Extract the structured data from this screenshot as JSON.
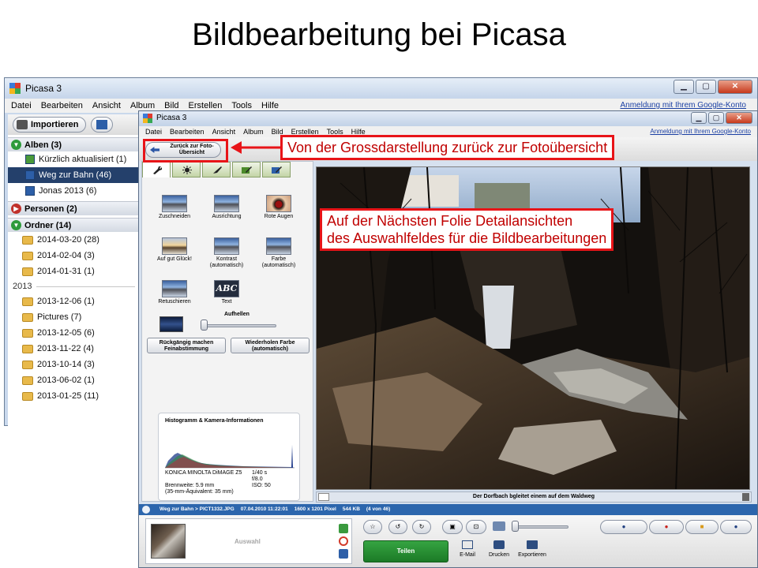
{
  "slide": {
    "title": "Bildbearbeitung bei Picasa"
  },
  "back_window": {
    "title": "Picasa 3",
    "menu": [
      "Datei",
      "Bearbeiten",
      "Ansicht",
      "Album",
      "Bild",
      "Erstellen",
      "Tools",
      "Hilfe"
    ],
    "login_link": "Anmeldung mit Ihrem Google-Konto",
    "import_label": "Importieren",
    "sections": {
      "albums": "Alben (3)",
      "people": "Personen (2)",
      "folders": "Ordner (14)"
    },
    "albums": [
      "Kürzlich aktualisiert (1)",
      "Weg zur Bahn (46)",
      "Jonas 2013 (6)"
    ],
    "folders_2014": [
      "2014-03-20 (28)",
      "2014-02-04 (3)",
      "2014-01-31 (1)"
    ],
    "year_divider": "2013",
    "folders_2013": [
      "2013-12-06 (1)",
      "Pictures (7)",
      "2013-12-05 (6)",
      "2013-11-22 (4)",
      "2013-10-14 (3)",
      "2013-06-02 (1)",
      "2013-01-25 (11)"
    ]
  },
  "front_window": {
    "title": "Picasa 3",
    "menu": [
      "Datei",
      "Bearbeiten",
      "Ansicht",
      "Album",
      "Bild",
      "Erstellen",
      "Tools",
      "Hilfe"
    ],
    "login_link": "Anmeldung mit Ihrem Google-Konto",
    "back_button": "Zurück zur Foto-Übersicht",
    "edit_tools": [
      "Zuschneiden",
      "Ausrichtung",
      "Rote Augen",
      "Auf gut Glück!",
      "Kontrast (automatisch)",
      "Farbe (automatisch)",
      "Retuschieren",
      "Text"
    ],
    "text_thumb": "ABC",
    "slider_label": "Aufhellen",
    "undo_button": "Rückgängig machen Feinabstimmung",
    "redo_button": "Wiederholen Farbe (automatisch)",
    "histogram": {
      "title": "Histogramm & Kamera-Informationen",
      "camera": "KONICA MINOLTA  DiMAGE Z5",
      "exposure": "1/40 s",
      "aperture": "f/8.0",
      "focal": "Brennweite: 5.9 mm",
      "iso": "ISO: 50",
      "equiv": "(35-mm-Äquivalent:  35 mm)"
    },
    "caption": "Der Dorfbach bgleitet einem auf dem Waldweg",
    "status": {
      "path": "Weg zur Bahn > PICT1332.JPG",
      "date": "07.04.2010 11:22:01",
      "dims": "1600 x 1201 Pixel",
      "size": "544 KB",
      "pos": "(4 von 46)"
    },
    "tray_label": "Auswahl",
    "share_button": "Teilen",
    "actions": [
      "E-Mail",
      "Drucken",
      "Exportieren"
    ]
  },
  "callouts": {
    "back_hint": "Von der Grossdarstellung zurück zur Fotoübersicht",
    "detail_hint_line1": "Auf der Nächsten Folie Detailansichten",
    "detail_hint_line2": "des Auswahlfeldes für die Bildbearbeitungen"
  },
  "colors": {
    "callout_red": "#e81418",
    "status_blue": "#2c66ad",
    "share_green": "#1c7a26"
  }
}
